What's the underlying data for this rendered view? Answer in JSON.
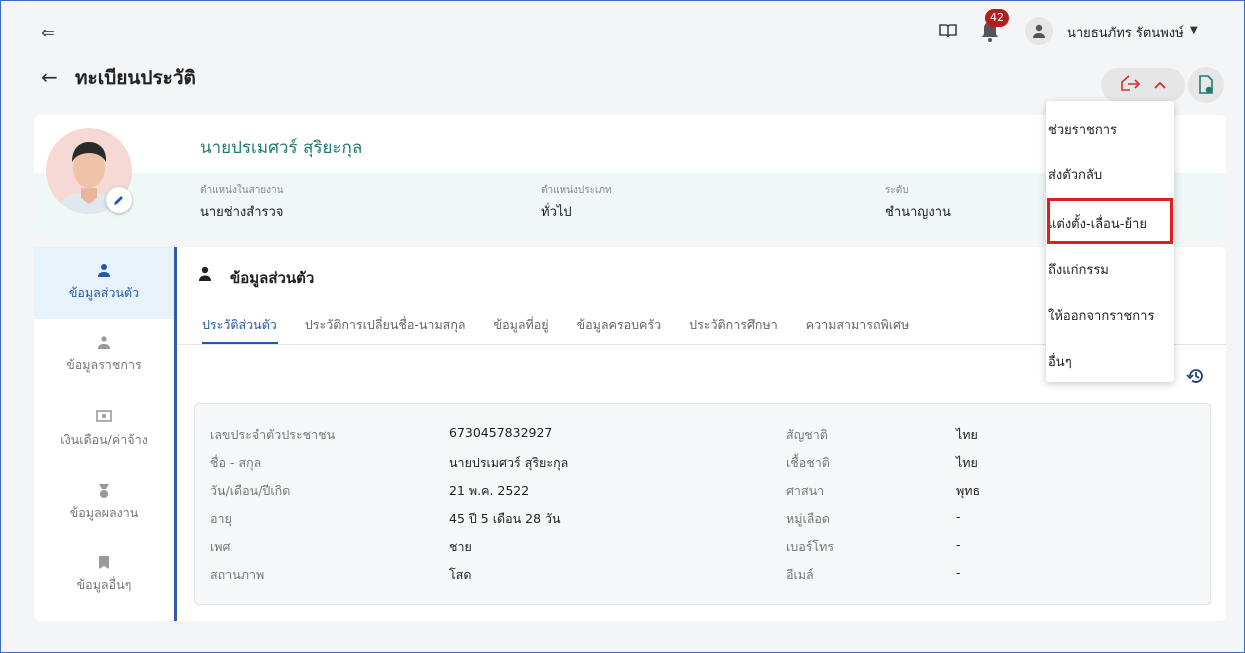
{
  "topbar": {
    "notification_count": "42",
    "user_name": "นายธนภัทร รัตนพงษ์"
  },
  "header": {
    "title": "ทะเบียนประวัติ"
  },
  "profile": {
    "name": "นายปรเมศวร์ สุริยะกุล",
    "fields": [
      {
        "label": "ตำแหน่งในสายงาน",
        "value": "นายช่างสำรวจ"
      },
      {
        "label": "ตำแหน่งประเภท",
        "value": "ทั่วไป"
      },
      {
        "label": "ระดับ",
        "value": "ชำนาญงาน"
      }
    ]
  },
  "sidebar": {
    "items": [
      {
        "label": "ข้อมูลส่วนตัว",
        "icon": "person-icon"
      },
      {
        "label": "ข้อมูลราชการ",
        "icon": "officer-icon"
      },
      {
        "label": "เงินเดือน/ค่าจ้าง",
        "icon": "money-icon"
      },
      {
        "label": "ข้อมูลผลงาน",
        "icon": "medal-icon"
      },
      {
        "label": "ข้อมูลอื่นๆ",
        "icon": "bookmark-icon"
      }
    ]
  },
  "section": {
    "title": "ข้อมูลส่วนตัว"
  },
  "tabs": [
    "ประวัติส่วนตัว",
    "ประวัติการเปลี่ยนชื่อ-นามสกุล",
    "ข้อมูลที่อยู่",
    "ข้อมูลครอบครัว",
    "ประวัติการศึกษา",
    "ความสามารถพิเศษ"
  ],
  "personal_left": [
    {
      "label": "เลขประจำตัวประชาชน",
      "value": "6730457832927"
    },
    {
      "label": "ชื่อ - สกุล",
      "value": "นายปรเมศวร์ สุริยะกุล"
    },
    {
      "label": "วัน/เดือน/ปีเกิด",
      "value": "21 พ.ค. 2522"
    },
    {
      "label": "อายุ",
      "value": "45 ปี 5 เดือน 28 วัน"
    },
    {
      "label": "เพศ",
      "value": "ชาย"
    },
    {
      "label": "สถานภาพ",
      "value": "โสด"
    }
  ],
  "personal_right": [
    {
      "label": "สัญชาติ",
      "value": "ไทย"
    },
    {
      "label": "เชื้อชาติ",
      "value": "ไทย"
    },
    {
      "label": "ศาสนา",
      "value": "พุทธ"
    },
    {
      "label": "หมู่เลือด",
      "value": "-"
    },
    {
      "label": "เบอร์โทร",
      "value": "-"
    },
    {
      "label": "อีเมล์",
      "value": "-"
    }
  ],
  "menu": {
    "items": [
      "ช่วยราชการ",
      "ส่งตัวกลับ",
      "แต่งตั้ง-เลื่อน-ย้าย",
      "ถึงแก่กรรม",
      "ให้ออกจากราชการ",
      "อื่นๆ"
    ],
    "highlighted_index": 2
  },
  "colors": {
    "accent": "#1f5aa8",
    "teal": "#1f7a73",
    "highlight": "#e01e1e",
    "badge": "#b71c1c"
  }
}
